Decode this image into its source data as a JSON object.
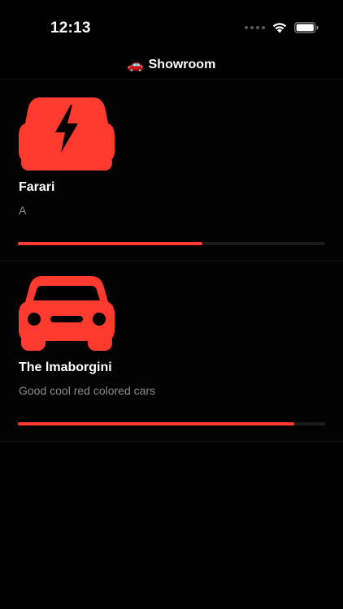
{
  "status_bar": {
    "time": "12:13"
  },
  "nav": {
    "emoji": "🚗",
    "title": "Showroom"
  },
  "colors": {
    "accent": "#ff3b30",
    "track": "#1b1b1d",
    "secondary_text": "#8a8a8a"
  },
  "cars": [
    {
      "icon": "car-bolt-icon",
      "name": "Farari",
      "description": "A",
      "progress": 0.6
    },
    {
      "icon": "car-front-icon",
      "name": "The lmaborgini",
      "description": "Good cool red colored cars",
      "progress": 0.9
    }
  ]
}
